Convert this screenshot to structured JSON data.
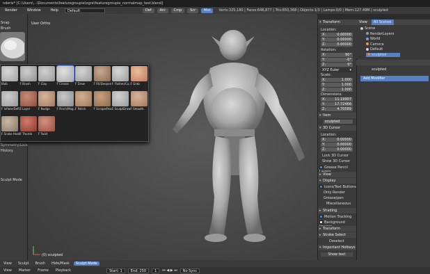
{
  "titlebar": {
    "text": "nderis* [C:\\Users\\...\\Documents\\featuregroupie\\ogre\\featuregroupie_normalmap_test.blend]"
  },
  "menubar": {
    "items": [
      "Render",
      "Window",
      "Help"
    ],
    "layout_value": "Default",
    "tabs": [
      "Def",
      "Ani",
      "Cmp",
      "Scr",
      "Mot"
    ],
    "stats": "Verts:325,180 | Faces:646,877 | Tris:650,368 | Objects:1/3 | Lamps:0/0 | Mem:127.49M | sculpted"
  },
  "left": {
    "snap": "Snap",
    "brush": "Brush",
    "symmetry": "Symmetry/Lock",
    "history": "History",
    "mode": "Sculpt Mode"
  },
  "brushes": [
    {
      "name": "Blob"
    },
    {
      "name": "F Brush"
    },
    {
      "name": "F Clay"
    },
    {
      "name": "F Crease"
    },
    {
      "name": "F Draw"
    },
    {
      "name": "F Fill/Deepen"
    },
    {
      "name": "F Flatten/Co..."
    },
    {
      "name": "F Grab"
    },
    {
      "name": "F Inflate/Defl..."
    },
    {
      "name": "F Layer"
    },
    {
      "name": "F Nudge"
    },
    {
      "name": "F Pinch/Mag..."
    },
    {
      "name": "F Polish"
    },
    {
      "name": "F Scrape/Pea..."
    },
    {
      "name": "F SculptDraw"
    },
    {
      "name": "F Smooth"
    },
    {
      "name": "F Snake Hook"
    },
    {
      "name": "F Thumb"
    },
    {
      "name": "F Twist"
    }
  ],
  "viewport": {
    "view_label": "User Ortho",
    "object_label": "(0) sculpted"
  },
  "npanel": {
    "transform": "Transform",
    "location": "Location:",
    "loc": [
      {
        "axis": "X:",
        "val": "0.00000"
      },
      {
        "axis": "Y:",
        "val": "0.00000"
      },
      {
        "axis": "Z:",
        "val": "0.00000"
      }
    ],
    "rotation": "Rotation:",
    "rot": [
      {
        "axis": "X:",
        "val": "90°"
      },
      {
        "axis": "Y:",
        "val": "-0°"
      },
      {
        "axis": "Z:",
        "val": "0°"
      }
    ],
    "rotmode": "XYZ Euler",
    "scale": "Scale:",
    "scl": [
      {
        "axis": "X:",
        "val": "1.000"
      },
      {
        "axis": "Y:",
        "val": "1.000"
      },
      {
        "axis": "Z:",
        "val": "1.000"
      }
    ],
    "dimensions": "Dimensions:",
    "dim": [
      {
        "axis": "X:",
        "val": "11.19907"
      },
      {
        "axis": "Y:",
        "val": "17.72466"
      },
      {
        "axis": "Z:",
        "val": "4.70589"
      }
    ],
    "item": "Item",
    "item_name": "sculpted",
    "cursor3d": "3D Cursor",
    "cursor_location": "Location:",
    "cur": [
      {
        "axis": "X:",
        "val": "0.00000"
      },
      {
        "axis": "Y:",
        "val": "0.00000"
      },
      {
        "axis": "Z:",
        "val": "0.00000"
      }
    ],
    "lock_camera": "Lock 3D Cursor",
    "show_cursor": "Show 3D Cursor",
    "grease_pencil": "Grease Pencil Layers",
    "view": "View",
    "display": "Display",
    "only_render": "Only Render",
    "grease_line": "Grease/pen",
    "miscellaneous": "Miscellaneous",
    "icons_text": "Icons/Text Buttons",
    "shading": "Shading",
    "motion_tracking": "Motion Tracking",
    "background_images": "Background Images",
    "transform_orientations": "Transform Orientations",
    "stroke_select": "Stroke Select",
    "deselect": "Deselect",
    "important_hotkeys": "Important Hotkeys",
    "show_text": "Show text"
  },
  "outliner": {
    "tabs": [
      "View",
      "All Scenes"
    ],
    "items": [
      {
        "label": "Scene",
        "color": "#cccccc"
      },
      {
        "label": "RenderLayers",
        "color": "#9a9a9a"
      },
      {
        "label": "World",
        "color": "#7fa3d6"
      },
      {
        "label": "Camera",
        "color": "#e0a040"
      },
      {
        "label": "Default",
        "color": "#d0d0d0"
      },
      {
        "label": "sculpted",
        "color": "#e08a40"
      }
    ]
  },
  "properties": {
    "object_name": "sculpted",
    "add_modifier": "Add Modifier"
  },
  "bottom": {
    "items": [
      "View",
      "Sculpt",
      "Brush",
      "Hide/Mask"
    ],
    "mode": "Sculpt Mode"
  },
  "timeline": {
    "items": [
      "View",
      "Marker",
      "Frame",
      "Playback"
    ],
    "start": "Start: 1",
    "end": "End: 250",
    "current": "1",
    "sync": "No Sync"
  }
}
